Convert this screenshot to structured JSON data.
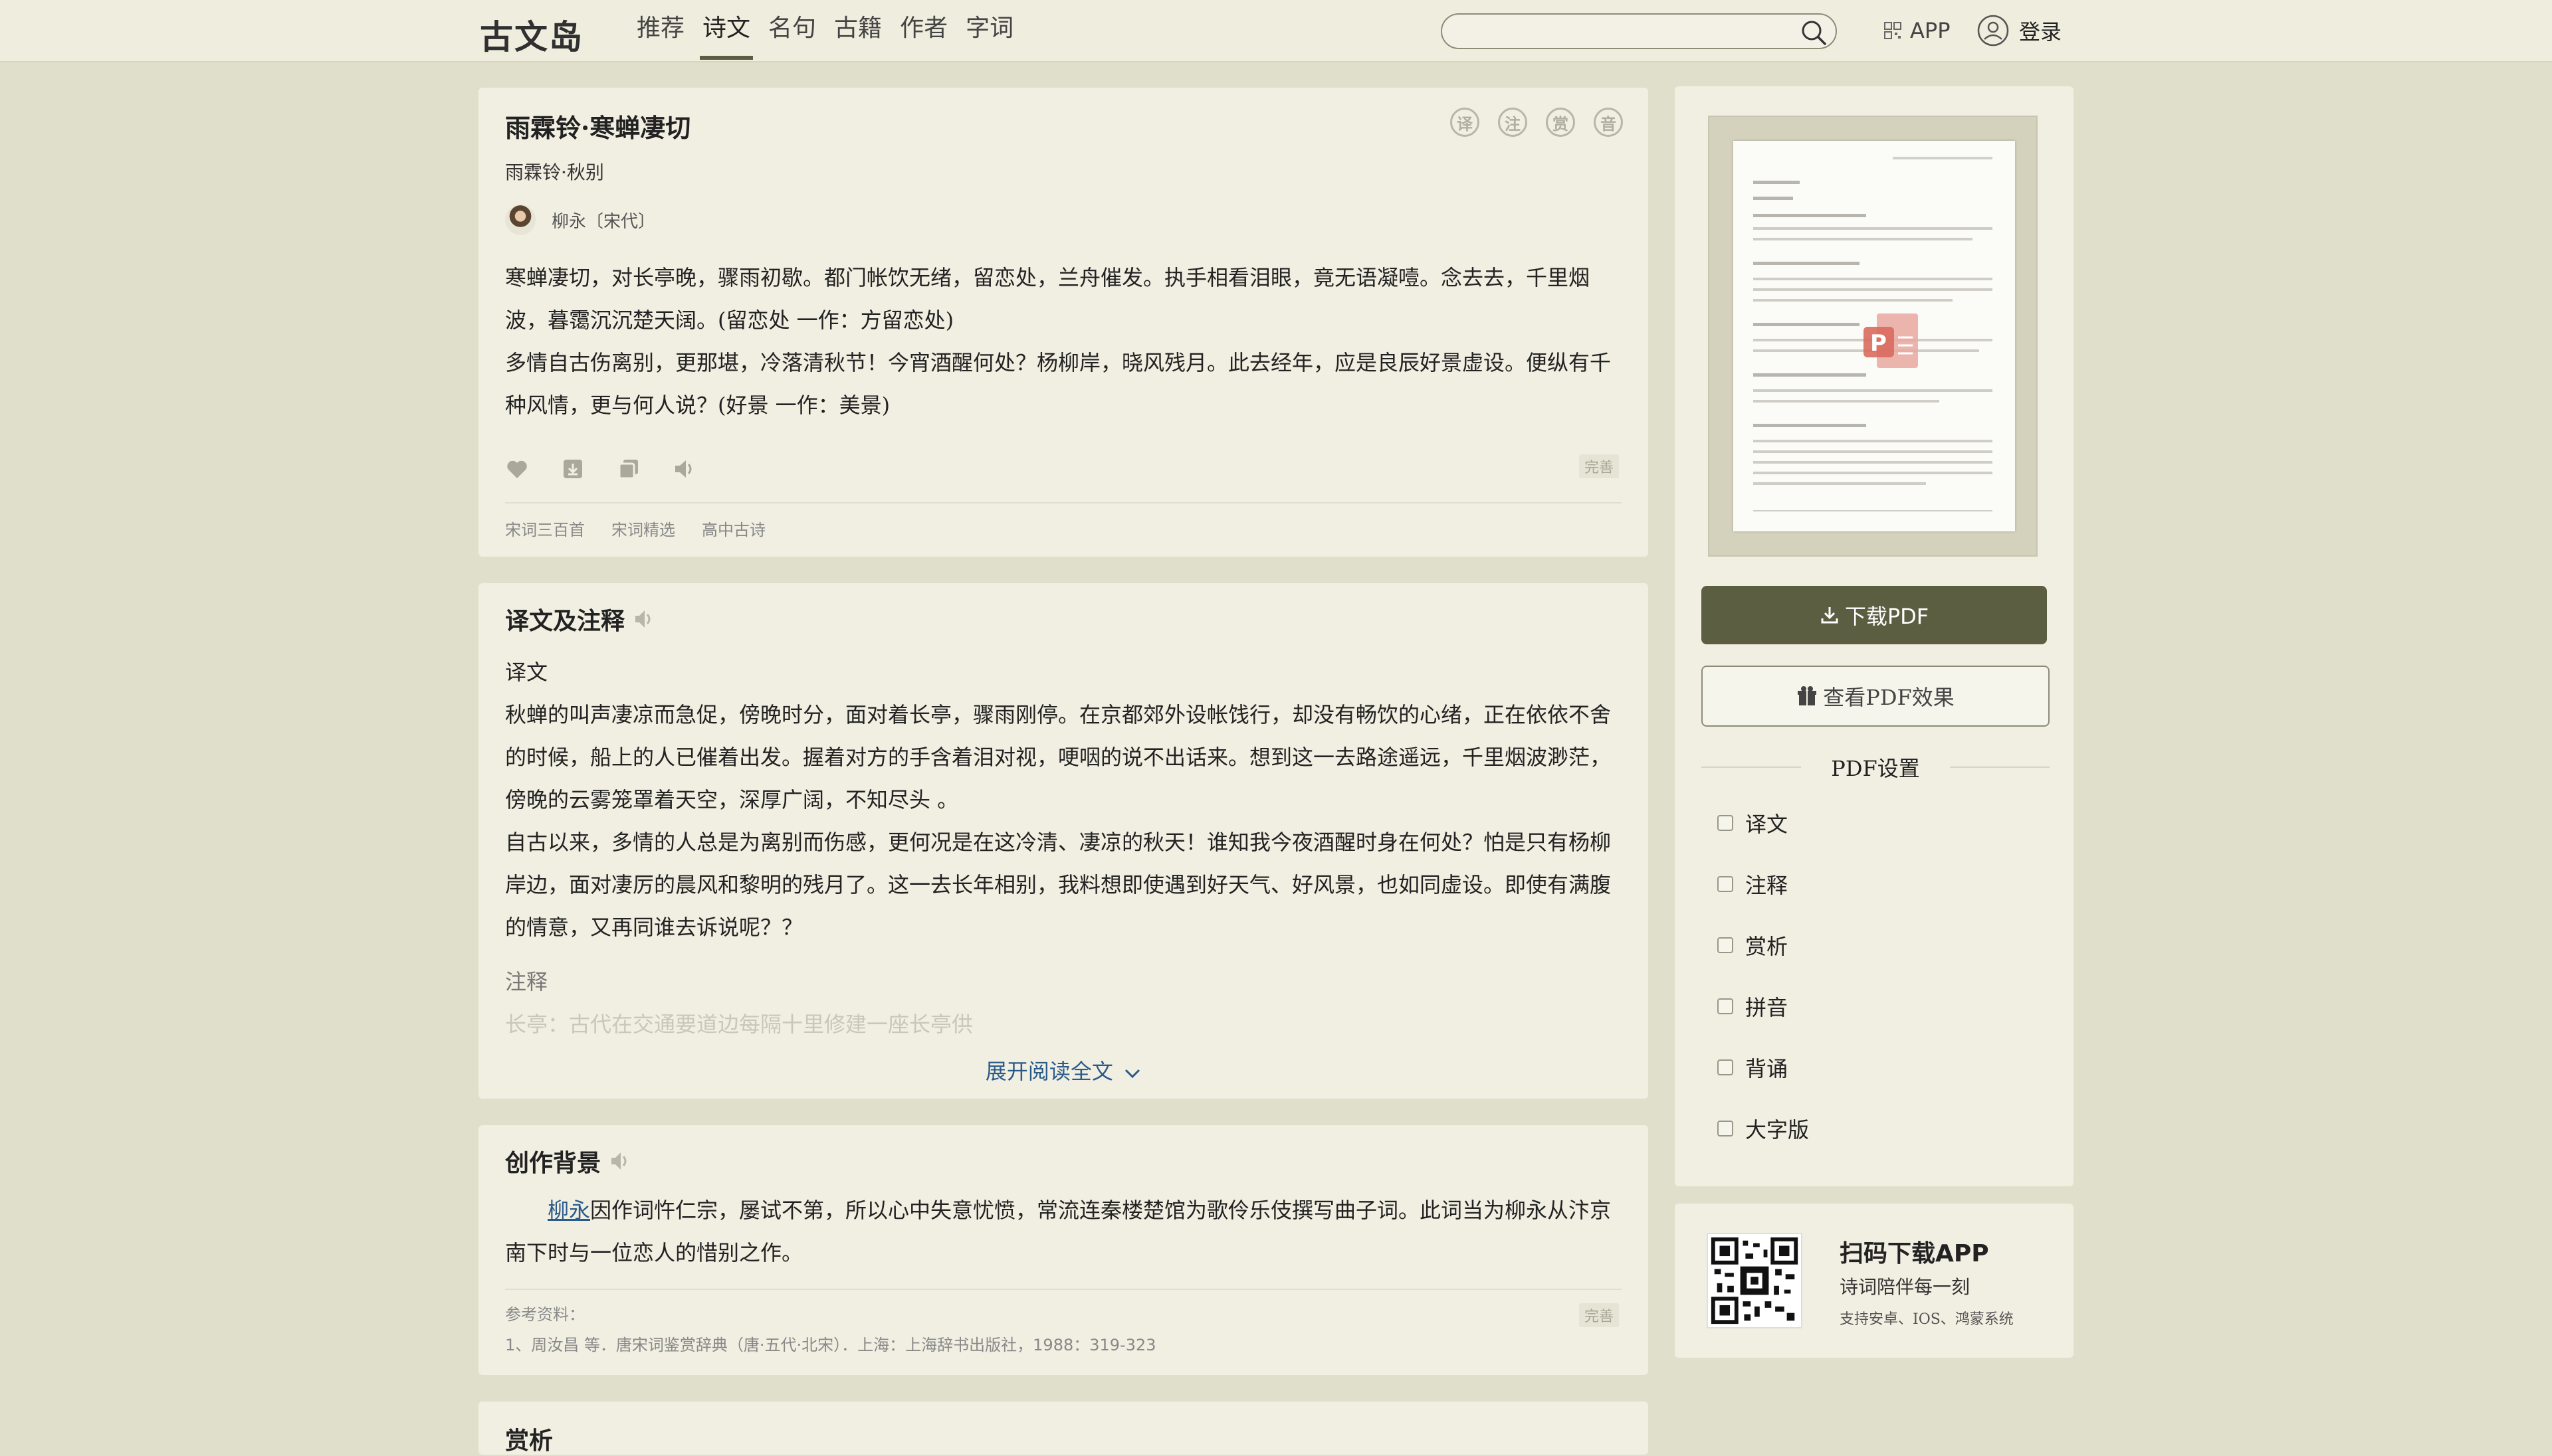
{
  "header": {
    "logo": "古文岛",
    "nav": [
      "推荐",
      "诗文",
      "名句",
      "古籍",
      "作者",
      "字词"
    ],
    "active_nav": "诗文",
    "search_placeholder": "",
    "app_label": "APP",
    "login_label": "登录"
  },
  "poem": {
    "title": "雨霖铃·寒蝉凄切",
    "subtitle": "雨霖铃·秋别",
    "author": "柳永〔宋代〕",
    "icons": [
      "译",
      "注",
      "赏",
      "音"
    ],
    "lines": [
      "寒蝉凄切，对长亭晚，骤雨初歇。都门帐饮无绪，留恋处，兰舟催发。执手相看泪眼，竟无语凝噎。念去去，千里烟",
      "波，暮霭沉沉楚天阔。(留恋处 一作：方留恋处)",
      "多情自古伤离别，更那堪，冷落清秋节！今宵酒醒何处？杨柳岸，晓风残月。此去经年，应是良辰好景虚设。便纵有千",
      "种风情，更与何人说？(好景 一作：美景)"
    ],
    "perfect_label": "完善",
    "tags": [
      "宋词三百首",
      "宋词精选",
      "高中古诗"
    ]
  },
  "translation": {
    "title": "译文及注释",
    "label_translation": "译文",
    "paragraphs": [
      "秋蝉的叫声凄凉而急促，傍晚时分，面对着长亭，骤雨刚停。在京都郊外设帐饯行，却没有畅饮的心绪，正在依依不舍",
      "的时候，船上的人已催着出发。握着对方的手含着泪对视，哽咽的说不出话来。想到这一去路途遥远，千里烟波渺茫，",
      "傍晚的云雾笼罩着天空，深厚广阔，不知尽头 。",
      "自古以来，多情的人总是为离别而伤感，更何况是在这冷清、凄凉的秋天！谁知我今夜酒醒时身在何处？怕是只有杨柳",
      "岸边，面对凄厉的晨风和黎明的残月了。这一去长年相别，我料想即使遇到好天气、好风景，也如同虚设。即使有满腹",
      "的情意，又再同谁去诉说呢？？"
    ],
    "label_notes": "注释",
    "note_preview": "长亭：古代在交通要道边每隔十里修建一座长亭供",
    "expand_label": "展开阅读全文"
  },
  "background": {
    "title": "创作背景",
    "author_link": "柳永",
    "line1": "因作词忤仁宗，屡试不第，所以心中失意忧愤，常流连秦楼楚馆为歌伶乐伎撰写曲子词。此词当为柳永从汴京",
    "line2": "南下时与一位恋人的惜别之作。",
    "ref_label": "参考资料：",
    "ref_item": "1、周汝昌 等．唐宋词鉴赏辞典（唐·五代·北宋）．上海：上海辞书出版社，1988：319-323",
    "perfect_label": "完善"
  },
  "next_section_title": "赏析",
  "sidebar": {
    "download_label": "下载PDF",
    "preview_label": "查看PDF效果",
    "settings_title": "PDF设置",
    "options": [
      "译文",
      "注释",
      "赏析",
      "拼音",
      "背诵",
      "大字版"
    ]
  },
  "app_promo": {
    "title": "扫码下载APP",
    "subtitle": "诗词陪伴每一刻",
    "platforms": "支持安卓、IOS、鸿蒙系统"
  }
}
